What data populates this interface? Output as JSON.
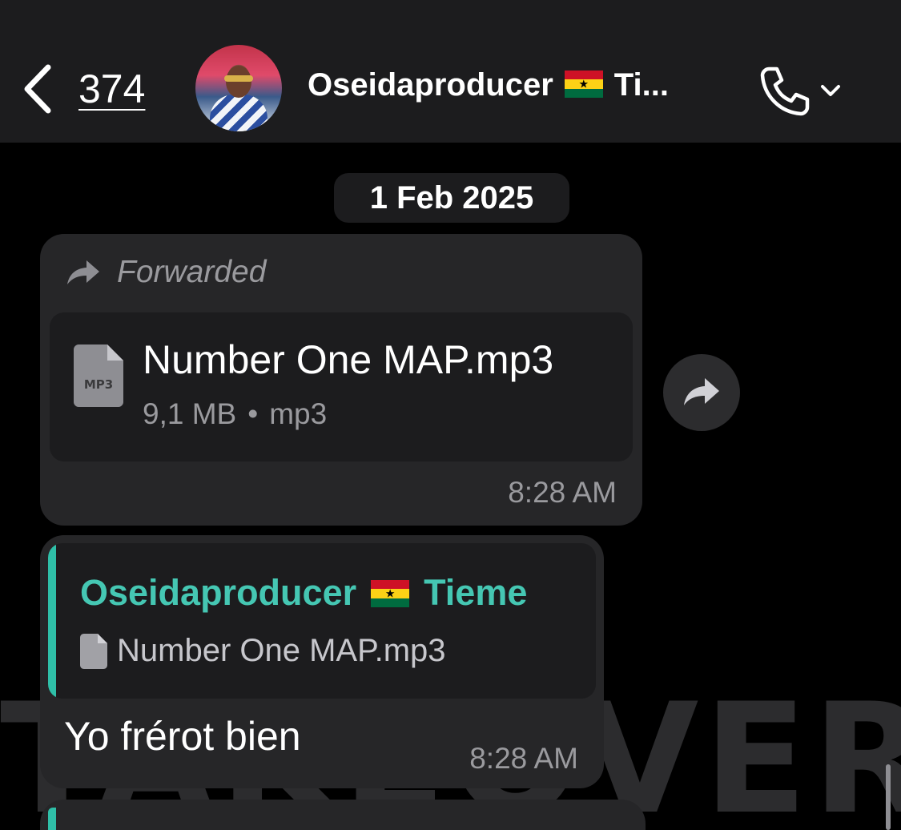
{
  "header": {
    "back_count": "374",
    "contact_name": "Oseidaproducer",
    "contact_name_suffix": "Ti...",
    "flag": "ghana-flag"
  },
  "chat": {
    "date_chip": "1 Feb 2025",
    "forwarded_message": {
      "forwarded_label": "Forwarded",
      "file_name": "Number One MAP.mp3",
      "file_icon_label": "MP3",
      "file_size": "9,1 MB",
      "file_type": "mp3",
      "meta_separator": "•",
      "time": "8:28 AM"
    },
    "reply_message": {
      "quoted_sender": "Oseidaproducer",
      "quoted_sender_suffix": "Tieme",
      "quoted_file": "Number One MAP.mp3",
      "text": "Yo frérot bien",
      "time": "8:28 AM"
    }
  },
  "colors": {
    "accent_teal": "#45c7b3",
    "bubble": "#262628",
    "background": "#000000"
  }
}
